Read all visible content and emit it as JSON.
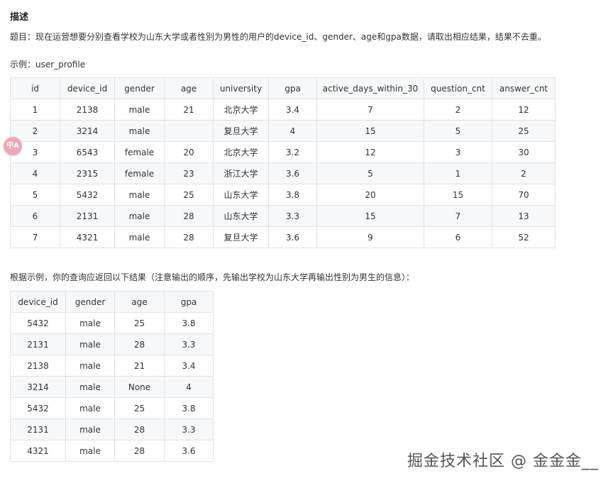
{
  "heading": "描述",
  "description": "题目：现在运营想要分别查看学校为山东大学或者性别为男性的用户的device_id、gender、age和gpa数据，请取出相应结果，结果不去重。",
  "example_label": "示例：user_profile",
  "result_label": "根据示例，你的查询应返回以下结果（注意输出的顺序，先输出学校为山东大学再输出性别为男生的信息）：",
  "badge_text": "中A",
  "watermark": "掘金技术社区 @ 金金金__",
  "user_profile": {
    "headers": [
      "id",
      "device_id",
      "gender",
      "age",
      "university",
      "gpa",
      "active_days_within_30",
      "question_cnt",
      "answer_cnt"
    ],
    "rows": [
      [
        "1",
        "2138",
        "male",
        "21",
        "北京大学",
        "3.4",
        "7",
        "2",
        "12"
      ],
      [
        "2",
        "3214",
        "male",
        "",
        "复旦大学",
        "4",
        "15",
        "5",
        "25"
      ],
      [
        "3",
        "6543",
        "female",
        "20",
        "北京大学",
        "3.2",
        "12",
        "3",
        "30"
      ],
      [
        "4",
        "2315",
        "female",
        "23",
        "浙江大学",
        "3.6",
        "5",
        "1",
        "2"
      ],
      [
        "5",
        "5432",
        "male",
        "25",
        "山东大学",
        "3.8",
        "20",
        "15",
        "70"
      ],
      [
        "6",
        "2131",
        "male",
        "28",
        "山东大学",
        "3.3",
        "15",
        "7",
        "13"
      ],
      [
        "7",
        "4321",
        "male",
        "28",
        "复旦大学",
        "3.6",
        "9",
        "6",
        "52"
      ]
    ]
  },
  "result_table": {
    "headers": [
      "device_id",
      "gender",
      "age",
      "gpa"
    ],
    "rows": [
      [
        "5432",
        "male",
        "25",
        "3.8"
      ],
      [
        "2131",
        "male",
        "28",
        "3.3"
      ],
      [
        "2138",
        "male",
        "21",
        "3.4"
      ],
      [
        "3214",
        "male",
        "None",
        "4"
      ],
      [
        "5432",
        "male",
        "25",
        "3.8"
      ],
      [
        "2131",
        "male",
        "28",
        "3.3"
      ],
      [
        "4321",
        "male",
        "28",
        "3.6"
      ]
    ]
  }
}
